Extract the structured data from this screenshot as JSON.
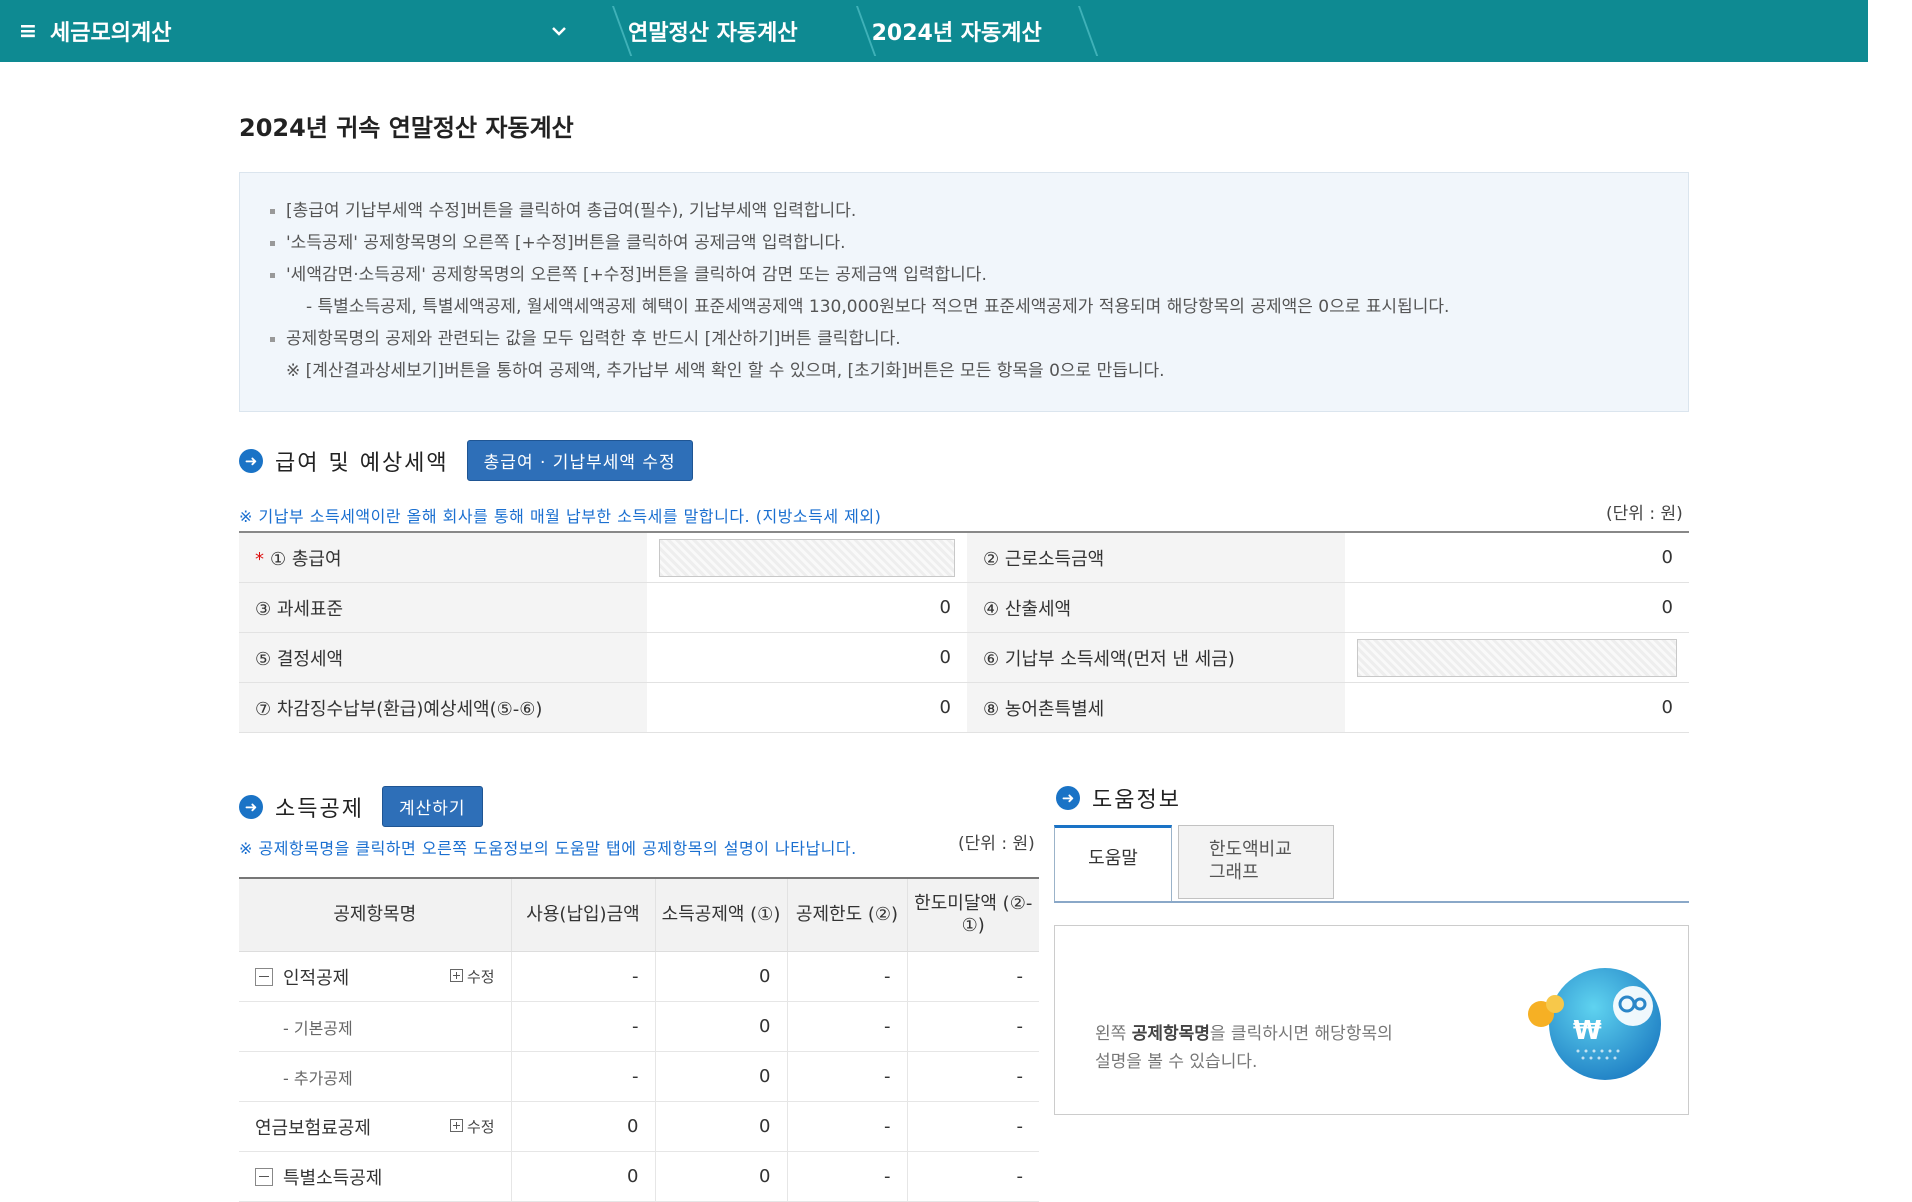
{
  "topbar": {
    "app_title": "세금모의계산",
    "crumb1": "연말정산 자동계산",
    "crumb2": "2024년 자동계산",
    "menu_icon": "≡",
    "chevron_icon": "⌄"
  },
  "page": {
    "title": "2024년 귀속 연말정산 자동계산"
  },
  "notice": {
    "items": [
      "[총급여 기납부세액 수정]버튼을 클릭하여 총급여(필수), 기납부세액 입력합니다.",
      "'소득공제' 공제항목명의 오른쪽 [+수정]버튼을 클릭하여 공제금액 입력합니다.",
      "'세액감면·소득공제' 공제항목명의 오른쪽 [+수정]버튼을 클릭하여 감면 또는 공제금액 입력합니다.",
      "- 특별소득공제, 특별세액공제, 월세액세액공제 혜택이 표준세액공제액 130,000원보다 적으면 표준세액공제가 적용되며 해당항목의 공제액은 0으로 표시됩니다.",
      "공제항목명의 공제와 관련되는 값을 모두 입력한 후 반드시 [계산하기]버튼 클릭합니다.",
      "※ [계산결과상세보기]버튼을 통하여 공제액, 추가납부 세액 확인 할 수 있으며, [초기화]버튼은 모든 항목을 0으로 만듭니다."
    ]
  },
  "salary": {
    "section_title": "급여 및 예상세액",
    "edit_button": "총급여 · 기납부세액 수정",
    "info": "※ 기납부 소득세액이란 올해 회사를 통해 매월 납부한 소득세를 말합니다. (지방소득세 제외)",
    "unit": "(단위 : 원)",
    "required_mark": "*",
    "rows": [
      {
        "l1": "① 총급여",
        "v1": "",
        "l2": "② 근로소득금액",
        "v2": "0"
      },
      {
        "l1": "③ 과세표준",
        "v1": "0",
        "l2": "④ 산출세액",
        "v2": "0"
      },
      {
        "l1": "⑤ 결정세액",
        "v1": "0",
        "l2": "⑥ 기납부 소득세액(먼저 낸 세금)",
        "v2": ""
      },
      {
        "l1": "⑦ 차감징수납부(환급)예상세액(⑤-⑥)",
        "v1": "0",
        "l2": "⑧ 농어촌특별세",
        "v2": "0"
      }
    ]
  },
  "deduction": {
    "section_title": "소득공제",
    "calc_button": "계산하기",
    "info": "※ 공제항목명을 클릭하면 오른쪽 도움정보의 도움말 탭에 공제항목의 설명이 나타납니다.",
    "unit": "(단위 : 원)",
    "edit_label": "수정",
    "headers": [
      "공제항목명",
      "사용(납입)금액",
      "소득공제액 (①)",
      "공제한도 (②)",
      "한도미달액 (②-①)"
    ],
    "rows": [
      {
        "name": "인적공제",
        "used": "-",
        "amount": "0",
        "limit": "-",
        "short": "-"
      },
      {
        "name": "- 기본공제",
        "used": "-",
        "amount": "0",
        "limit": "-",
        "short": "-"
      },
      {
        "name": "- 추가공제",
        "used": "-",
        "amount": "0",
        "limit": "-",
        "short": "-"
      },
      {
        "name": "연금보험료공제",
        "used": "0",
        "amount": "0",
        "limit": "-",
        "short": "-"
      },
      {
        "name": "특별소득공제",
        "used": "0",
        "amount": "0",
        "limit": "-",
        "short": "-"
      }
    ]
  },
  "help": {
    "section_title": "도움정보",
    "tab_help": "도움말",
    "tab_graph_line1": "한도액비교",
    "tab_graph_line2": "그래프",
    "text_line1_pre": "왼쪽 ",
    "text_line1_bold": "공제항목명",
    "text_line1_post": "을 클릭하시면 해당항목의",
    "text_line2": "설명을 볼 수 있습니다.",
    "won_symbol": "₩"
  },
  "colors": {
    "topbar": "#0e8a92",
    "button": "#2e6fb8",
    "info_text": "#1a6fd0",
    "section_icon": "#1a73c6"
  }
}
